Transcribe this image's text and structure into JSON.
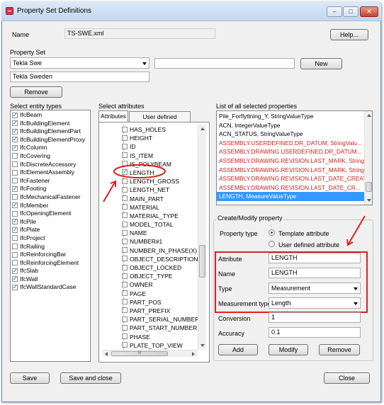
{
  "window": {
    "title": "Property Set Definitions",
    "controls": {
      "minimize": "–",
      "maximize": "□",
      "close": "✕"
    }
  },
  "name_row": {
    "label": "Name",
    "value": "TS-SWE.xml",
    "help_label": "Help..."
  },
  "property_set": {
    "label": "Property Set",
    "selected": "Tekla Swe",
    "new_value": "",
    "new_label": "New",
    "description": "Tekla Sweden",
    "remove_label": "Remove"
  },
  "entity_types": {
    "label": "Select entity types",
    "items": [
      {
        "label": "IfcBeam",
        "checked": true
      },
      {
        "label": "IfcBuildingElement",
        "checked": true
      },
      {
        "label": "IfcBuildingElementPart",
        "checked": true
      },
      {
        "label": "IfcBuildingElementProxy",
        "checked": true
      },
      {
        "label": "IfcColumn",
        "checked": true
      },
      {
        "label": "IfcCovering",
        "checked": false
      },
      {
        "label": "IfcDiscreteAccessory",
        "checked": false
      },
      {
        "label": "IfcElementAssembly",
        "checked": false
      },
      {
        "label": "IfcFastener",
        "checked": false
      },
      {
        "label": "IfcFooting",
        "checked": true
      },
      {
        "label": "IfcMechanicalFastener",
        "checked": false
      },
      {
        "label": "IfcMember",
        "checked": true
      },
      {
        "label": "IfcOpeningElement",
        "checked": false
      },
      {
        "label": "IfcPile",
        "checked": true
      },
      {
        "label": "IfcPlate",
        "checked": true
      },
      {
        "label": "IfcProject",
        "checked": false
      },
      {
        "label": "IfcRailing",
        "checked": false
      },
      {
        "label": "IfcReinforcingBar",
        "checked": false
      },
      {
        "label": "IfcReinforcingElement",
        "checked": false
      },
      {
        "label": "IfcSlab",
        "checked": true
      },
      {
        "label": "IfcWall",
        "checked": true
      },
      {
        "label": "IfcWallStandardCase",
        "checked": true
      }
    ]
  },
  "attributes": {
    "label": "Select attributes",
    "tabs": [
      "Attributes",
      "User defined attributes"
    ],
    "items": [
      {
        "label": "HAS_HOLES",
        "checked": false
      },
      {
        "label": "HEIGHT",
        "checked": false
      },
      {
        "label": "ID",
        "checked": false
      },
      {
        "label": "IS_ITEM",
        "checked": false
      },
      {
        "label": "IS_POLYBEAM",
        "checked": false
      },
      {
        "label": "LENGTH",
        "checked": true
      },
      {
        "label": "LENGTH_GROSS",
        "checked": false
      },
      {
        "label": "LENGTH_NET",
        "checked": false
      },
      {
        "label": "MAIN_PART",
        "checked": false
      },
      {
        "label": "MATERIAL",
        "checked": false
      },
      {
        "label": "MATERIAL_TYPE",
        "checked": false
      },
      {
        "label": "MODEL_TOTAL",
        "checked": false
      },
      {
        "label": "NAME",
        "checked": false
      },
      {
        "label": "NUMBER#1",
        "checked": false
      },
      {
        "label": "NUMBER_IN_PHASE(X)",
        "checked": false
      },
      {
        "label": "OBJECT_DESCRIPTION",
        "checked": false
      },
      {
        "label": "OBJECT_LOCKED",
        "checked": false
      },
      {
        "label": "OBJECT_TYPE",
        "checked": false
      },
      {
        "label": "OWNER",
        "checked": false
      },
      {
        "label": "PAGE",
        "checked": false
      },
      {
        "label": "PART_POS",
        "checked": false
      },
      {
        "label": "PART_PREFIX",
        "checked": false
      },
      {
        "label": "PART_SERIAL_NUMBER",
        "checked": false
      },
      {
        "label": "PART_START_NUMBER",
        "checked": false
      },
      {
        "label": "PHASE",
        "checked": false
      },
      {
        "label": "PLATE_TOP_VIEW",
        "checked": false
      }
    ],
    "hscroll_thumb_glyph": "III"
  },
  "selected_properties": {
    "label": "List of all selected properties",
    "items": [
      {
        "text": "Pile_Forflyttning_Y,  StringValueType",
        "style": "normal"
      },
      {
        "text": "ACN,  IntegerValueType",
        "style": "normal"
      },
      {
        "text": "ACN_STATUS,  StringValueType",
        "style": "normal"
      },
      {
        "text": "ASSEMBLY.USERDEFINED.DR_DATUM,  StringValu...",
        "style": "red"
      },
      {
        "text": "ASSEMBLY.DRAWING.USERDEFINED.DR_DATUM...",
        "style": "red"
      },
      {
        "text": "ASSEMBLY.DRAWING.REVISION.LAST_MARK,  StringValueType",
        "style": "red"
      },
      {
        "text": "ASSEMBLY.DRAWING.REVISION.LAST_MARK,  StringValueType",
        "style": "red"
      },
      {
        "text": "ASSEMBLY.DRAWING.REVISION.LAST_DATE_CREATE,  Time...",
        "style": "red"
      },
      {
        "text": "ASSEMBLY.DRAWING.REVISION.LAST_DATE_CR...",
        "style": "red"
      },
      {
        "text": "LENGTH,  MeasureValueType",
        "style": "selected"
      }
    ]
  },
  "create_modify": {
    "label": "Create/Modify property",
    "property_type_label": "Property type",
    "radio_template": "Template attribute",
    "radio_user": "User defined attribute",
    "attribute_label": "Attribute",
    "attribute_value": "LENGTH",
    "name_label": "Name",
    "name_value": "LENGTH",
    "type_label": "Type",
    "type_value": "Measurement",
    "measurement_type_label": "Measurement type",
    "measurement_type_value": "Length",
    "conversion_label": "Conversion",
    "conversion_value": "1",
    "accuracy_label": "Accuracy",
    "accuracy_value": "0.1",
    "add_label": "Add",
    "modify_label": "Modify",
    "remove_label": "Remove"
  },
  "footer": {
    "save_label": "Save",
    "save_close_label": "Save and close",
    "close_label": "Close"
  },
  "annotation_color": "#e02020"
}
